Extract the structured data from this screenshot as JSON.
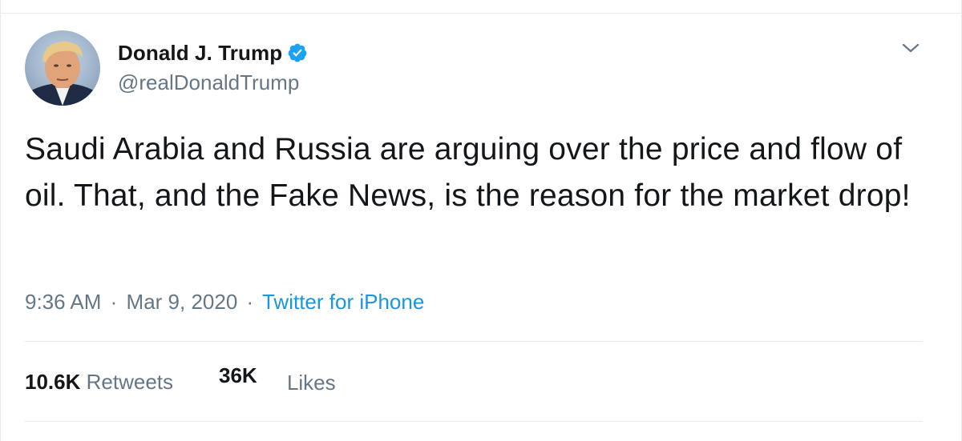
{
  "tweet": {
    "author": {
      "display_name": "Donald J. Trump",
      "handle": "@realDonaldTrump",
      "verified": true
    },
    "text": "Saudi Arabia and Russia are arguing over the price and flow of oil. That, and the Fake News, is the reason for the market drop!",
    "time": "9:36 AM",
    "date": "Mar 9, 2020",
    "separator": "·",
    "source": "Twitter for iPhone",
    "retweets": {
      "count": "10.6K",
      "label": "Retweets"
    },
    "likes": {
      "count": "36K",
      "label": "Likes"
    }
  },
  "icons": {
    "avatar": "profile-photo",
    "verified": "verified-badge-icon",
    "menu": "chevron-down-icon"
  },
  "colors": {
    "text_primary": "#14171a",
    "text_secondary": "#657786",
    "link": "#1b95e0",
    "verified_badge": "#1da1f2",
    "divider": "#e6ecf0"
  }
}
